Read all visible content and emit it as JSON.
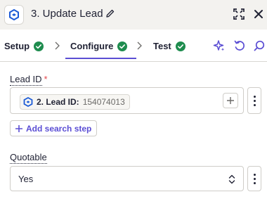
{
  "header": {
    "title": "3. Update Lead",
    "app_icon": "app-logo-icon",
    "edit_icon": "pencil-icon",
    "expand_icon": "expand-icon",
    "close_icon": "close-icon"
  },
  "tabs": [
    {
      "label": "Setup",
      "status_icon": "check-circle-icon"
    },
    {
      "label": "Configure",
      "status_icon": "check-circle-icon",
      "active": true
    },
    {
      "label": "Test",
      "status_icon": "check-circle-icon"
    }
  ],
  "toolbar": {
    "ai_icon": "sparkle-icon",
    "refresh_icon": "refresh-icon",
    "search_icon": "search-icon"
  },
  "lead_id": {
    "label": "Lead ID",
    "required_mark": "*",
    "pill_key": "2. Lead ID:",
    "pill_value": "154074013",
    "add_search_label": "Add search step"
  },
  "quotable": {
    "label": "Quotable",
    "value": "Yes"
  },
  "colors": {
    "accent": "#5b4ed4",
    "success": "#1e8c4e",
    "required": "#e5484d",
    "header_bg": "#f3f2ef"
  }
}
